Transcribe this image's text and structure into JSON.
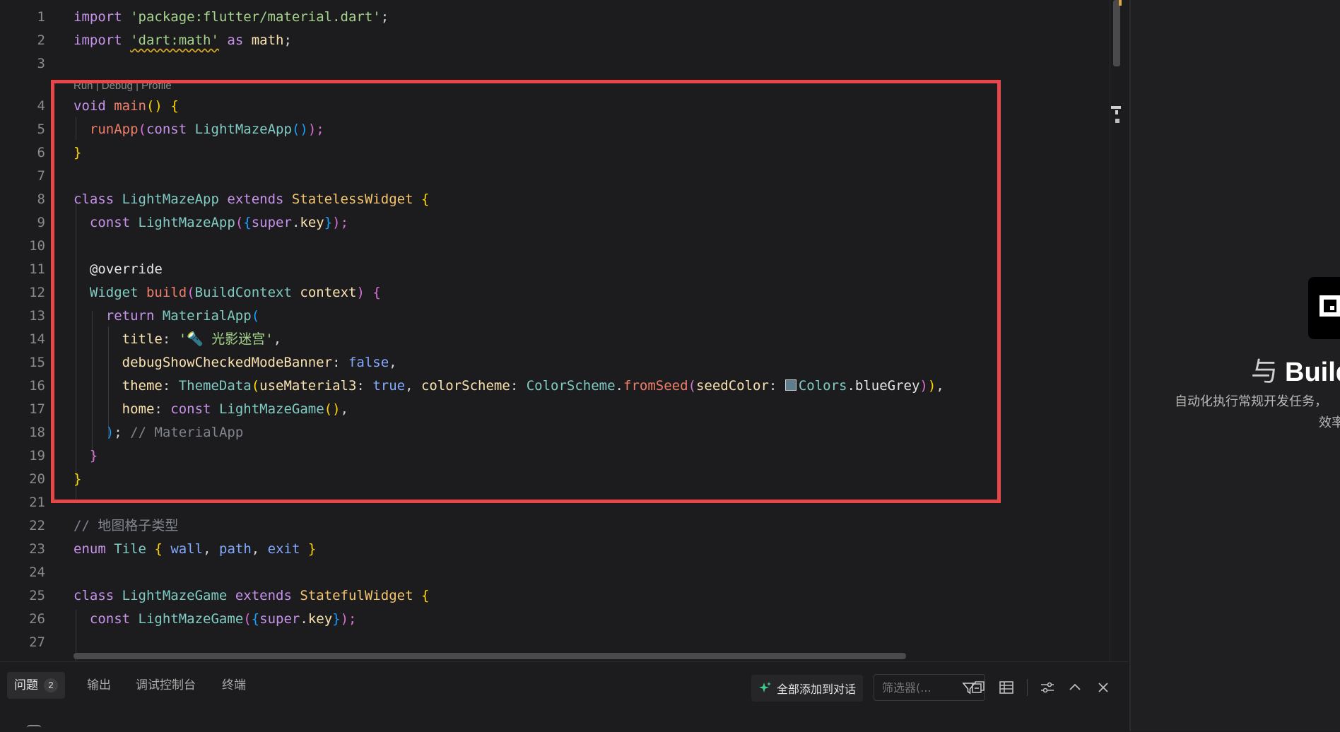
{
  "editor": {
    "codelens": "Run | Debug | Profile",
    "line_numbers": [
      "1",
      "2",
      "3",
      "4",
      "5",
      "6",
      "7",
      "8",
      "9",
      "10",
      "11",
      "12",
      "13",
      "14",
      "15",
      "16",
      "17",
      "18",
      "19",
      "20",
      "21",
      "22",
      "23",
      "24",
      "25",
      "26",
      "27"
    ],
    "lines": {
      "l1": [
        "import",
        " ",
        "'package:flutter/material.dart'",
        ";"
      ],
      "l2": [
        "import",
        " ",
        "'dart:math'",
        " ",
        "as",
        " ",
        "math",
        ";"
      ],
      "l4": [
        "void",
        " ",
        "main",
        "()",
        " ",
        "{"
      ],
      "l5": [
        "  ",
        "runApp",
        "(",
        "const",
        " ",
        "LightMazeApp",
        "()",
        ");"
      ],
      "l6": [
        "}"
      ],
      "l8": [
        "class",
        " ",
        "LightMazeApp",
        " ",
        "extends",
        " ",
        "StatelessWidget",
        " ",
        "{"
      ],
      "l9": [
        "  ",
        "const",
        " ",
        "LightMazeApp",
        "(",
        "{",
        "super",
        ".",
        "key",
        "}",
        ");"
      ],
      "l11": [
        "  ",
        "@override"
      ],
      "l12": [
        "  ",
        "Widget",
        " ",
        "build",
        "(",
        "BuildContext",
        " ",
        "context",
        ")",
        " ",
        "{"
      ],
      "l13": [
        "    ",
        "return",
        " ",
        "MaterialApp",
        "("
      ],
      "l14": [
        "      ",
        "title",
        ": ",
        "'🔦 光影迷宫'",
        ","
      ],
      "l15": [
        "      ",
        "debugShowCheckedModeBanner",
        ": ",
        "false",
        ","
      ],
      "l16": [
        "      ",
        "theme",
        ": ",
        "ThemeData",
        "(",
        "useMaterial3",
        ": ",
        "true",
        ", ",
        "colorScheme",
        ": ",
        "ColorScheme",
        ".",
        "fromSeed",
        "(",
        "seedColor",
        ": ",
        "Colors",
        ".",
        "blueGrey",
        ")",
        ")",
        ","
      ],
      "l17": [
        "      ",
        "home",
        ": ",
        "const",
        " ",
        "LightMazeGame",
        "()",
        ","
      ],
      "l18": [
        "    ",
        ")",
        ";",
        " ",
        "// MaterialApp"
      ],
      "l19": [
        "  ",
        "}"
      ],
      "l20": [
        "}"
      ],
      "l22": [
        "// 地图格子类型"
      ],
      "l23": [
        "enum",
        " ",
        "Tile",
        " ",
        "{",
        " ",
        "wall",
        ", ",
        "path",
        ", ",
        "exit",
        " ",
        "}"
      ],
      "l25": [
        "class",
        " ",
        "LightMazeGame",
        " ",
        "extends",
        " ",
        "StatefulWidget",
        " ",
        "{"
      ],
      "l26": [
        "  ",
        "const",
        " ",
        "LightMazeGame",
        "(",
        "{",
        "super",
        ".",
        "key",
        "}",
        ");"
      ]
    },
    "seed_color": "#607d8b"
  },
  "right_panel": {
    "title_glyph": "与",
    "title": "Build",
    "description": "自动化执行常规开发任务，",
    "description_line2": "效率"
  },
  "bottom_panel": {
    "tabs": [
      {
        "label": "问题",
        "badge": "2"
      },
      {
        "label": "输出"
      },
      {
        "label": "调试控制台"
      },
      {
        "label": "终端"
      }
    ],
    "add_all_label": "全部添加到对话",
    "filter_placeholder": "筛选器(..."
  },
  "colors": {
    "highlight_border": "#e8474a",
    "background": "#1c1c1e"
  }
}
